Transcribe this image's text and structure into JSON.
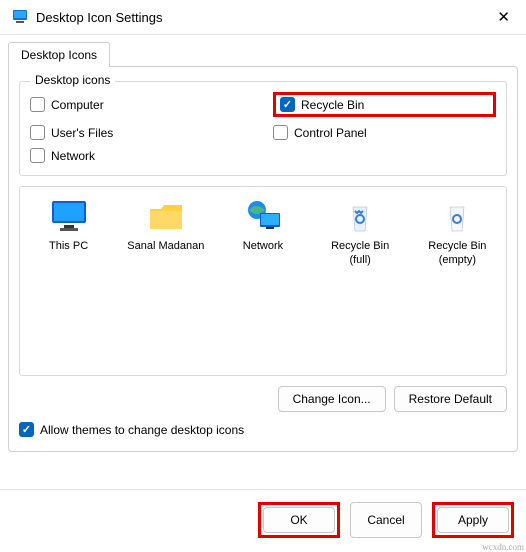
{
  "title": "Desktop Icon Settings",
  "tab": "Desktop Icons",
  "group_legend": "Desktop icons",
  "checks": {
    "computer": "Computer",
    "recycle": "Recycle Bin",
    "userfiles": "User's Files",
    "control": "Control Panel",
    "network": "Network"
  },
  "icons": {
    "thispc": "This PC",
    "sanal": "Sanal Madanan",
    "network": "Network",
    "rbfull": "Recycle Bin (full)",
    "rbempty": "Recycle Bin (empty)"
  },
  "buttons": {
    "change_icon": "Change Icon...",
    "restore": "Restore Default",
    "ok": "OK",
    "cancel": "Cancel",
    "apply": "Apply"
  },
  "themes_label": "Allow themes to change desktop icons",
  "watermark": "wcxdn.com"
}
